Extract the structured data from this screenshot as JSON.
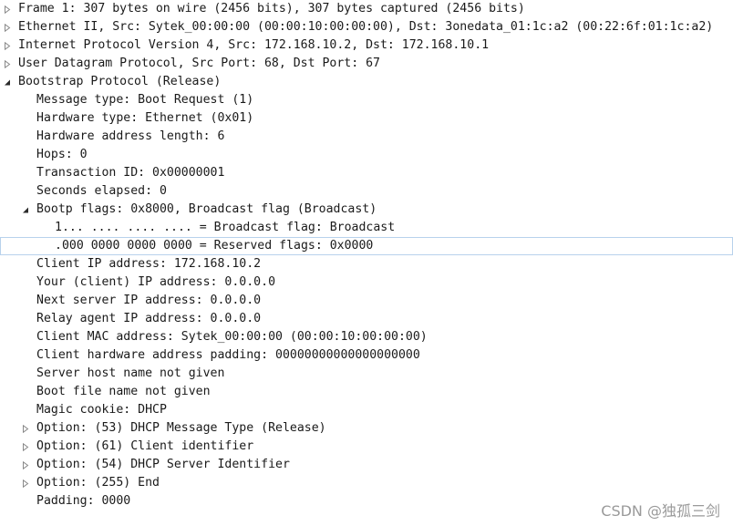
{
  "tree": [
    {
      "text": "Frame 1: 307 bytes on wire (2456 bits), 307 bytes captured (2456 bits)",
      "level": 0,
      "toggle": "collapsed"
    },
    {
      "text": "Ethernet II, Src: Sytek_00:00:00 (00:00:10:00:00:00), Dst: 3onedata_01:1c:a2 (00:22:6f:01:1c:a2)",
      "level": 0,
      "toggle": "collapsed"
    },
    {
      "text": "Internet Protocol Version 4, Src: 172.168.10.2, Dst: 172.168.10.1",
      "level": 0,
      "toggle": "collapsed"
    },
    {
      "text": "User Datagram Protocol, Src Port: 68, Dst Port: 67",
      "level": 0,
      "toggle": "collapsed"
    },
    {
      "text": "Bootstrap Protocol (Release)",
      "level": 0,
      "toggle": "expanded"
    },
    {
      "text": "Message type: Boot Request (1)",
      "level": 1,
      "toggle": "none"
    },
    {
      "text": "Hardware type: Ethernet (0x01)",
      "level": 1,
      "toggle": "none"
    },
    {
      "text": "Hardware address length: 6",
      "level": 1,
      "toggle": "none"
    },
    {
      "text": "Hops: 0",
      "level": 1,
      "toggle": "none"
    },
    {
      "text": "Transaction ID: 0x00000001",
      "level": 1,
      "toggle": "none"
    },
    {
      "text": "Seconds elapsed: 0",
      "level": 1,
      "toggle": "none"
    },
    {
      "text": "Bootp flags: 0x8000, Broadcast flag (Broadcast)",
      "level": 1,
      "toggle": "expanded"
    },
    {
      "text": "1... .... .... .... = Broadcast flag: Broadcast",
      "level": 2,
      "toggle": "none"
    },
    {
      "text": ".000 0000 0000 0000 = Reserved flags: 0x0000",
      "level": 2,
      "toggle": "none",
      "selected": true
    },
    {
      "text": "Client IP address: 172.168.10.2",
      "level": 1,
      "toggle": "none"
    },
    {
      "text": "Your (client) IP address: 0.0.0.0",
      "level": 1,
      "toggle": "none"
    },
    {
      "text": "Next server IP address: 0.0.0.0",
      "level": 1,
      "toggle": "none"
    },
    {
      "text": "Relay agent IP address: 0.0.0.0",
      "level": 1,
      "toggle": "none"
    },
    {
      "text": "Client MAC address: Sytek_00:00:00 (00:00:10:00:00:00)",
      "level": 1,
      "toggle": "none"
    },
    {
      "text": "Client hardware address padding: 00000000000000000000",
      "level": 1,
      "toggle": "none"
    },
    {
      "text": "Server host name not given",
      "level": 1,
      "toggle": "none"
    },
    {
      "text": "Boot file name not given",
      "level": 1,
      "toggle": "none"
    },
    {
      "text": "Magic cookie: DHCP",
      "level": 1,
      "toggle": "none"
    },
    {
      "text": "Option: (53) DHCP Message Type (Release)",
      "level": 1,
      "toggle": "collapsed"
    },
    {
      "text": "Option: (61) Client identifier",
      "level": 1,
      "toggle": "collapsed"
    },
    {
      "text": "Option: (54) DHCP Server Identifier",
      "level": 1,
      "toggle": "collapsed"
    },
    {
      "text": "Option: (255) End",
      "level": 1,
      "toggle": "collapsed"
    },
    {
      "text": "Padding: 0000",
      "level": 1,
      "toggle": "none"
    }
  ],
  "watermark": "CSDN @独孤三剑",
  "colors": {
    "text": "#1a1a1a",
    "toggle_collapsed": "#8a8a8a",
    "toggle_expanded": "#2b2b2b",
    "selection_border": "#b8d2ec",
    "watermark": "#9a9a9a"
  }
}
